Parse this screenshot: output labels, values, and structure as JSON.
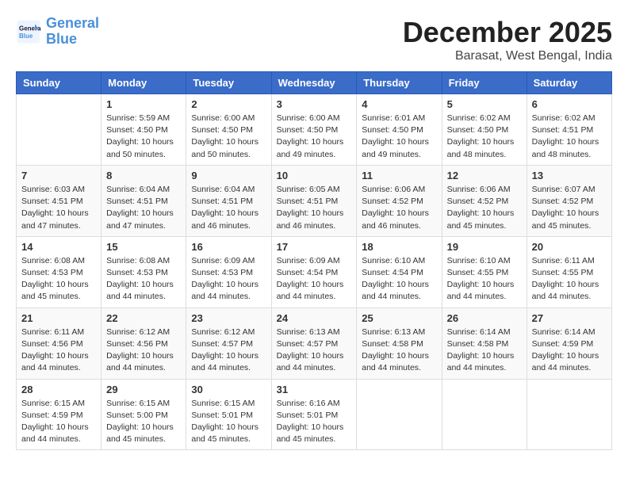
{
  "header": {
    "logo_line1": "General",
    "logo_line2": "Blue",
    "month": "December 2025",
    "location": "Barasat, West Bengal, India"
  },
  "days_of_week": [
    "Sunday",
    "Monday",
    "Tuesday",
    "Wednesday",
    "Thursday",
    "Friday",
    "Saturday"
  ],
  "weeks": [
    [
      {
        "day": "",
        "info": ""
      },
      {
        "day": "1",
        "info": "Sunrise: 5:59 AM\nSunset: 4:50 PM\nDaylight: 10 hours\nand 50 minutes."
      },
      {
        "day": "2",
        "info": "Sunrise: 6:00 AM\nSunset: 4:50 PM\nDaylight: 10 hours\nand 50 minutes."
      },
      {
        "day": "3",
        "info": "Sunrise: 6:00 AM\nSunset: 4:50 PM\nDaylight: 10 hours\nand 49 minutes."
      },
      {
        "day": "4",
        "info": "Sunrise: 6:01 AM\nSunset: 4:50 PM\nDaylight: 10 hours\nand 49 minutes."
      },
      {
        "day": "5",
        "info": "Sunrise: 6:02 AM\nSunset: 4:50 PM\nDaylight: 10 hours\nand 48 minutes."
      },
      {
        "day": "6",
        "info": "Sunrise: 6:02 AM\nSunset: 4:51 PM\nDaylight: 10 hours\nand 48 minutes."
      }
    ],
    [
      {
        "day": "7",
        "info": "Sunrise: 6:03 AM\nSunset: 4:51 PM\nDaylight: 10 hours\nand 47 minutes."
      },
      {
        "day": "8",
        "info": "Sunrise: 6:04 AM\nSunset: 4:51 PM\nDaylight: 10 hours\nand 47 minutes."
      },
      {
        "day": "9",
        "info": "Sunrise: 6:04 AM\nSunset: 4:51 PM\nDaylight: 10 hours\nand 46 minutes."
      },
      {
        "day": "10",
        "info": "Sunrise: 6:05 AM\nSunset: 4:51 PM\nDaylight: 10 hours\nand 46 minutes."
      },
      {
        "day": "11",
        "info": "Sunrise: 6:06 AM\nSunset: 4:52 PM\nDaylight: 10 hours\nand 46 minutes."
      },
      {
        "day": "12",
        "info": "Sunrise: 6:06 AM\nSunset: 4:52 PM\nDaylight: 10 hours\nand 45 minutes."
      },
      {
        "day": "13",
        "info": "Sunrise: 6:07 AM\nSunset: 4:52 PM\nDaylight: 10 hours\nand 45 minutes."
      }
    ],
    [
      {
        "day": "14",
        "info": "Sunrise: 6:08 AM\nSunset: 4:53 PM\nDaylight: 10 hours\nand 45 minutes."
      },
      {
        "day": "15",
        "info": "Sunrise: 6:08 AM\nSunset: 4:53 PM\nDaylight: 10 hours\nand 44 minutes."
      },
      {
        "day": "16",
        "info": "Sunrise: 6:09 AM\nSunset: 4:53 PM\nDaylight: 10 hours\nand 44 minutes."
      },
      {
        "day": "17",
        "info": "Sunrise: 6:09 AM\nSunset: 4:54 PM\nDaylight: 10 hours\nand 44 minutes."
      },
      {
        "day": "18",
        "info": "Sunrise: 6:10 AM\nSunset: 4:54 PM\nDaylight: 10 hours\nand 44 minutes."
      },
      {
        "day": "19",
        "info": "Sunrise: 6:10 AM\nSunset: 4:55 PM\nDaylight: 10 hours\nand 44 minutes."
      },
      {
        "day": "20",
        "info": "Sunrise: 6:11 AM\nSunset: 4:55 PM\nDaylight: 10 hours\nand 44 minutes."
      }
    ],
    [
      {
        "day": "21",
        "info": "Sunrise: 6:11 AM\nSunset: 4:56 PM\nDaylight: 10 hours\nand 44 minutes."
      },
      {
        "day": "22",
        "info": "Sunrise: 6:12 AM\nSunset: 4:56 PM\nDaylight: 10 hours\nand 44 minutes."
      },
      {
        "day": "23",
        "info": "Sunrise: 6:12 AM\nSunset: 4:57 PM\nDaylight: 10 hours\nand 44 minutes."
      },
      {
        "day": "24",
        "info": "Sunrise: 6:13 AM\nSunset: 4:57 PM\nDaylight: 10 hours\nand 44 minutes."
      },
      {
        "day": "25",
        "info": "Sunrise: 6:13 AM\nSunset: 4:58 PM\nDaylight: 10 hours\nand 44 minutes."
      },
      {
        "day": "26",
        "info": "Sunrise: 6:14 AM\nSunset: 4:58 PM\nDaylight: 10 hours\nand 44 minutes."
      },
      {
        "day": "27",
        "info": "Sunrise: 6:14 AM\nSunset: 4:59 PM\nDaylight: 10 hours\nand 44 minutes."
      }
    ],
    [
      {
        "day": "28",
        "info": "Sunrise: 6:15 AM\nSunset: 4:59 PM\nDaylight: 10 hours\nand 44 minutes."
      },
      {
        "day": "29",
        "info": "Sunrise: 6:15 AM\nSunset: 5:00 PM\nDaylight: 10 hours\nand 45 minutes."
      },
      {
        "day": "30",
        "info": "Sunrise: 6:15 AM\nSunset: 5:01 PM\nDaylight: 10 hours\nand 45 minutes."
      },
      {
        "day": "31",
        "info": "Sunrise: 6:16 AM\nSunset: 5:01 PM\nDaylight: 10 hours\nand 45 minutes."
      },
      {
        "day": "",
        "info": ""
      },
      {
        "day": "",
        "info": ""
      },
      {
        "day": "",
        "info": ""
      }
    ]
  ]
}
